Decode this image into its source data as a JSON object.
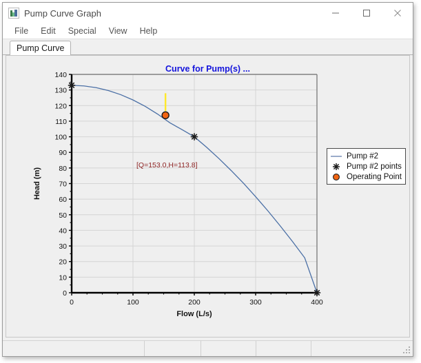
{
  "window": {
    "title": "Pump Curve Graph",
    "icon": "chart-icon",
    "minimize_label": "Minimize",
    "maximize_label": "Maximize",
    "close_label": "Close"
  },
  "menu": {
    "items": [
      {
        "label": "File"
      },
      {
        "label": "Edit"
      },
      {
        "label": "Special"
      },
      {
        "label": "View"
      },
      {
        "label": "Help"
      }
    ]
  },
  "tabs": [
    {
      "label": "Pump Curve",
      "active": true
    }
  ],
  "statusbar": {
    "cells": [
      "",
      "",
      "",
      "",
      ""
    ],
    "grip": "resize-grip"
  },
  "colors": {
    "title_text": "#1414dc",
    "curve": "#4a6fa5",
    "marker": "#1a1a1a",
    "operating_point_fill": "#f26513",
    "operating_point_stroke": "#1a1a1a",
    "annotation_text": "#8d2323",
    "leader_line": "#ffe92b",
    "plot_background": "#efefef",
    "grid": "#d4d4d4",
    "axis": "#000000"
  },
  "chart_data": {
    "type": "line",
    "title": "Curve for Pump(s) ...",
    "xlabel": "Flow (L/s)",
    "ylabel": "Head (m)",
    "xlim": [
      0,
      400
    ],
    "ylim": [
      0,
      140
    ],
    "xticks": [
      0,
      100,
      200,
      300,
      400
    ],
    "yticks": [
      0,
      10,
      20,
      30,
      40,
      50,
      60,
      70,
      80,
      90,
      100,
      110,
      120,
      130,
      140
    ],
    "grid": true,
    "legend_position": "top-right-outside",
    "series": [
      {
        "name": "Pump #2",
        "render": "line",
        "x": [
          0,
          20,
          40,
          60,
          80,
          100,
          120,
          140,
          160,
          180,
          200,
          220,
          240,
          260,
          280,
          300,
          320,
          340,
          360,
          380,
          400
        ],
        "y": [
          133.0,
          132.6,
          131.5,
          129.6,
          127.0,
          123.6,
          119.5,
          114.6,
          109.0,
          104.6,
          100.0,
          93.3,
          86.1,
          78.4,
          70.3,
          61.6,
          52.5,
          42.9,
          32.9,
          22.4,
          0.0
        ]
      },
      {
        "name": "Pump #2 points",
        "render": "scatter-star",
        "x": [
          0,
          200,
          400
        ],
        "y": [
          133.0,
          100.0,
          0.0
        ]
      },
      {
        "name": "Operating Point",
        "render": "scatter-circle",
        "x": [
          153.0
        ],
        "y": [
          113.8
        ]
      }
    ],
    "annotations": [
      {
        "text": "[Q=153.0,H=113.8]",
        "x": 153.0,
        "y": 113.8,
        "leader": true
      }
    ]
  },
  "legend": {
    "entries": [
      {
        "label": "Pump #2",
        "key": "line-key"
      },
      {
        "label": "Pump #2 points",
        "key": "star-key"
      },
      {
        "label": "Operating Point",
        "key": "circle-key"
      }
    ]
  }
}
